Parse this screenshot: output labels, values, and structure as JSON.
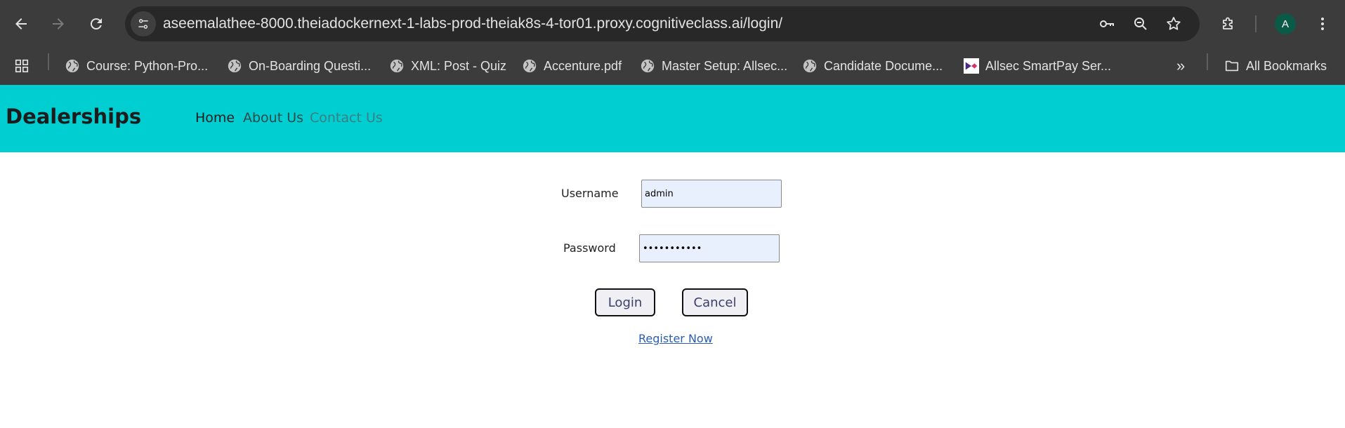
{
  "browser": {
    "url": "aseemalathee-8000.theiadockernext-1-labs-prod-theiak8s-4-tor01.proxy.cognitiveclass.ai/login/",
    "profile_initial": "A",
    "bookmarks": [
      {
        "label": "Course: Python-Pro...",
        "icon": "globe-icon"
      },
      {
        "label": "On-Boarding Questi...",
        "icon": "globe-icon"
      },
      {
        "label": "XML: Post - Quiz",
        "icon": "globe-icon"
      },
      {
        "label": "Accenture.pdf",
        "icon": "globe-icon"
      },
      {
        "label": "Master Setup: Allsec...",
        "icon": "globe-icon"
      },
      {
        "label": "Candidate Docume...",
        "icon": "globe-icon"
      },
      {
        "label": "Allsec SmartPay Ser...",
        "icon": "allsec-logo-icon"
      }
    ],
    "all_bookmarks_label": "All Bookmarks",
    "overflow_label": "»"
  },
  "navbar": {
    "brand": "Dealerships",
    "links": [
      {
        "label": "Home"
      },
      {
        "label": "About Us"
      },
      {
        "label": "Contact Us"
      }
    ]
  },
  "login": {
    "username_label": "Username",
    "username_value": "admin",
    "password_label": "Password",
    "password_value": "adminadmin1",
    "login_label": "Login",
    "cancel_label": "Cancel",
    "register_label": "Register Now"
  },
  "colors": {
    "navbar_bg": "#00ced1",
    "chrome_bg": "#3c3c3c",
    "omnibox_bg": "#282828",
    "input_bg": "#e8f0fe",
    "link": "#2a5db0"
  }
}
